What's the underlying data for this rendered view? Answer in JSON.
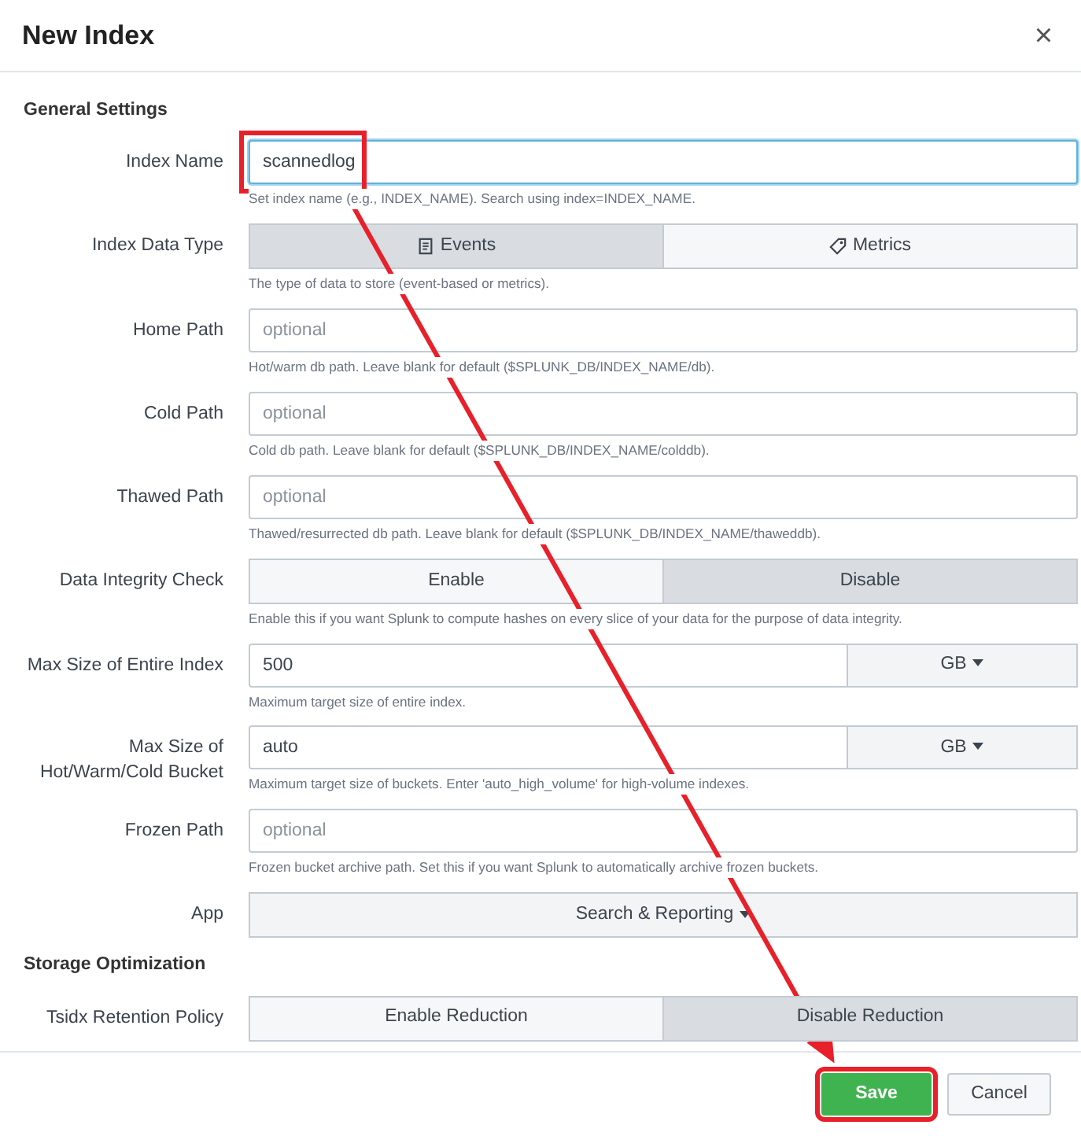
{
  "dialog": {
    "title": "New Index",
    "close": "×"
  },
  "sections": [
    {
      "title": "General Settings",
      "fields": [
        {
          "kind": "text",
          "label": "Index Name",
          "value": "scannedlog",
          "focused": true,
          "highlighted": true,
          "hint": "Set index name (e.g., INDEX_NAME). Search using index=INDEX_NAME."
        },
        {
          "kind": "toggle",
          "label": "Index Data Type",
          "options": [
            {
              "label": "Events",
              "kind": "events",
              "selected": true
            },
            {
              "label": "Metrics",
              "kind": "metrics",
              "selected": false
            }
          ],
          "hint": "The type of data to store (event-based or metrics)."
        },
        {
          "kind": "text",
          "label": "Home Path",
          "placeholder": "optional",
          "focused": false,
          "highlighted": false,
          "hint": "Hot/warm db path. Leave blank for default ($SPLUNK_DB/INDEX_NAME/db)."
        },
        {
          "kind": "text",
          "label": "Cold Path",
          "placeholder": "optional",
          "focused": false,
          "highlighted": false,
          "hint": "Cold db path. Leave blank for default ($SPLUNK_DB/INDEX_NAME/colddb)."
        },
        {
          "kind": "text",
          "label": "Thawed Path",
          "placeholder": "optional",
          "focused": false,
          "highlighted": false,
          "hint": "Thawed/resurrected db path. Leave blank for default ($SPLUNK_DB/INDEX_NAME/thaweddb)."
        },
        {
          "kind": "toggle",
          "label": "Data Integrity Check",
          "options": [
            {
              "label": "Enable",
              "selected": false
            },
            {
              "label": "Disable",
              "selected": true
            }
          ],
          "hint": "Enable this if you want Splunk to compute hashes on every slice of your data for the purpose of data integrity."
        },
        {
          "kind": "unit",
          "label": "Max Size of Entire Index",
          "value": "500",
          "unit": "GB",
          "hint": "Maximum target size of entire index."
        },
        {
          "kind": "unit",
          "label": "Max Size of Hot/Warm/Cold Bucket",
          "value": "auto",
          "unit": "GB",
          "hint": "Maximum target size of buckets. Enter 'auto_high_volume' for high-volume indexes."
        },
        {
          "kind": "text",
          "label": "Frozen Path",
          "placeholder": "optional",
          "focused": false,
          "highlighted": false,
          "hint": "Frozen bucket archive path. Set this if you want Splunk to automatically archive frozen buckets."
        },
        {
          "kind": "select",
          "label": "App",
          "value": "Search & Reporting"
        }
      ]
    },
    {
      "title": "Storage Optimization",
      "fields": [
        {
          "kind": "toggle",
          "label": "Tsidx Retention Policy",
          "options": [
            {
              "label": "Enable Reduction",
              "selected": false
            },
            {
              "label": "Disable Reduction",
              "selected": true
            }
          ]
        }
      ]
    }
  ],
  "buttons": [
    {
      "label": "Save",
      "kind": "primary",
      "highlighted": true
    },
    {
      "label": "Cancel",
      "kind": "secondary",
      "highlighted": false
    }
  ],
  "arrow": true
}
